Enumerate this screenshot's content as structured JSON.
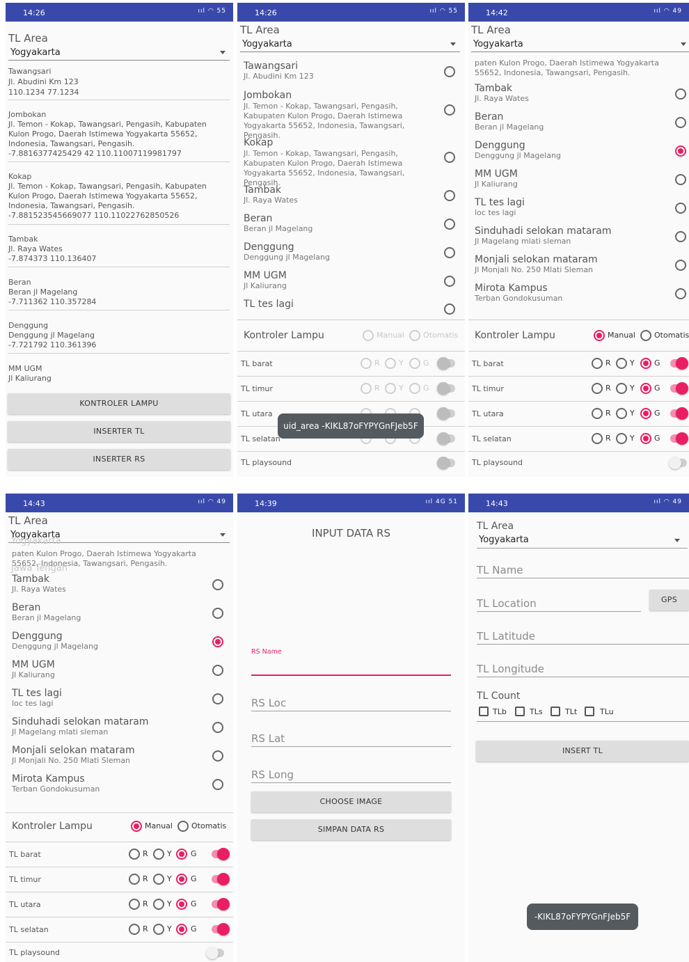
{
  "s1": {
    "time": "14:26",
    "status_icons": "ııl ◠ 55",
    "tl_area_label": "TL Area",
    "area_value": "Yogyakarta",
    "items": [
      {
        "name": "Tawangsari",
        "address": "Jl. Abudini Km 123",
        "coords": "110.1234   77.1234"
      },
      {
        "name": "Jombokan",
        "address": "Jl. Temon - Kokap, Tawangsari, Pengasih, Kabupaten Kulon Progo, Daerah Istimewa Yogyakarta 55652, Indonesia, Tawangsari, Pengasih.",
        "coords": "-7.8816377425429 42   110.11007119981797"
      },
      {
        "name": "Kokap",
        "address": "Jl. Temon - Kokap, Tawangsari, Pengasih, Kabupaten Kulon Progo, Daerah Istimewa Yogyakarta 55652, Indonesia, Tawangsari, Pengasih.",
        "coords": "-7.881523545669077   110.11022762850526"
      },
      {
        "name": "Tambak",
        "address": "Jl. Raya Wates",
        "coords": "-7.874373   110.136407"
      },
      {
        "name": "Beran",
        "address": "Beran jl Magelang",
        "coords": "-7.711362   110.357284"
      },
      {
        "name": "Denggung",
        "address": "Denggung  jl Magelang",
        "coords": "-7.721792   110.361396"
      },
      {
        "name": "MM UGM",
        "address": "Jl Kaliurang",
        "coords": ""
      }
    ],
    "buttons": [
      "KONTROLER LAMPU",
      "INSERTER TL",
      "INSERTER RS"
    ]
  },
  "s2": {
    "time": "14:26",
    "status_icons": "ııl ◠ 55",
    "tl_area_label": "TL Area",
    "area_value": "Yogyakarta",
    "items": [
      {
        "name": "Tawangsari",
        "address": "Jl. Abudini Km 123"
      },
      {
        "name": "Jombokan",
        "address": "Jl. Temon - Kokap, Tawangsari, Pengasih, Kabupaten Kulon Progo, Daerah Istimewa Yogyakarta 55652, Indonesia, Tawangsari, Pengasih."
      },
      {
        "name": "Kokap",
        "address": "Jl. Temon - Kokap, Tawangsari, Pengasih, Kabupaten Kulon Progo, Daerah Istimewa Yogyakarta 55652, Indonesia, Tawangsari, Pengasih."
      },
      {
        "name": "Tambak",
        "address": "Jl. Raya Wates"
      },
      {
        "name": "Beran",
        "address": "Beran jl Magelang"
      },
      {
        "name": "Denggung",
        "address": "Denggung  jl Magelang"
      },
      {
        "name": "MM UGM",
        "address": "Jl Kaliurang"
      },
      {
        "name": "TL tes lagi",
        "address": ""
      }
    ],
    "kontroler_label": "Kontroler Lampu",
    "manual": "Manual",
    "otomatis": "Otomatis",
    "lights": [
      "TL barat",
      "TL timur",
      "TL utara",
      "TL selatan",
      "TL playsound"
    ],
    "r": "R",
    "y": "Y",
    "g": "G",
    "toast": "uid_area -KIKL87oFYPYGnFJeb5F"
  },
  "s3": {
    "time": "14:42",
    "status_icons": "ııl ◠ 49",
    "tl_area_label": "TL Area",
    "area_value": "Yogyakarta",
    "partial_text": "paten Kulon Progo, Daerah Istimewa Yogyakarta 55652, Indonesia, Tawangsari, Pengasih.",
    "items": [
      {
        "name": "Tambak",
        "address": "Jl. Raya Wates",
        "selected": false
      },
      {
        "name": "Beran",
        "address": "Beran jl Magelang",
        "selected": false
      },
      {
        "name": "Denggung",
        "address": "Denggung  jl Magelang",
        "selected": true
      },
      {
        "name": "MM UGM",
        "address": "Jl Kaliurang",
        "selected": false
      },
      {
        "name": "TL tes lagi",
        "address": "loc tes lagi",
        "selected": false
      },
      {
        "name": "Sinduhadi selokan mataram",
        "address": "Jl Magelang mlati sleman",
        "selected": false
      },
      {
        "name": "Monjali selokan mataram",
        "address": "Jl Monjali No. 250 Mlati Sleman",
        "selected": false
      },
      {
        "name": "Mirota Kampus",
        "address": "Terban Gondokusuman",
        "selected": false
      }
    ],
    "kontroler_label": "Kontroler Lampu",
    "manual": "Manual",
    "otomatis": "Otomatis",
    "lights": [
      "TL barat",
      "TL timur",
      "TL utara",
      "TL selatan",
      "TL playsound"
    ],
    "r": "R",
    "y": "Y",
    "g": "G"
  },
  "s4": {
    "time": "14:43",
    "status_icons": "ııl ◠ 49",
    "tl_area_label": "TL Area",
    "area_value": "Yogyakarta",
    "ghost_1": "Yogyakarta",
    "ghost_2": "Jawa Tengah",
    "partial_text": "paten Kulon Progo, Daerah Istimewa Yogyakarta 55652, Indonesia, Tawangsari, Pengasih.",
    "items": [
      {
        "name": "Tambak",
        "address": "Jl. Raya Wates",
        "selected": false
      },
      {
        "name": "Beran",
        "address": "Beran jl Magelang",
        "selected": false
      },
      {
        "name": "Denggung",
        "address": "Denggung  jl Magelang",
        "selected": true
      },
      {
        "name": "MM UGM",
        "address": "Jl Kaliurang",
        "selected": false
      },
      {
        "name": "TL tes lagi",
        "address": "loc tes lagi",
        "selected": false
      },
      {
        "name": "Sinduhadi selokan mataram",
        "address": "Jl Magelang mlati sleman",
        "selected": false
      },
      {
        "name": "Monjali selokan mataram",
        "address": "Jl Monjali No. 250 Mlati Sleman",
        "selected": false
      },
      {
        "name": "Mirota Kampus",
        "address": "Terban Gondokusuman",
        "selected": false
      }
    ],
    "kontroler_label": "Kontroler Lampu",
    "manual": "Manual",
    "otomatis": "Otomatis",
    "lights": [
      "TL barat",
      "TL timur",
      "TL utara",
      "TL selatan",
      "TL playsound"
    ],
    "r": "R",
    "y": "Y",
    "g": "G"
  },
  "s5": {
    "time": "14:39",
    "status_icons": "ııl 4G 51",
    "title": "INPUT DATA RS",
    "rs_name_label": "RS Name",
    "rs_loc": "RS Loc",
    "rs_lat": "RS Lat",
    "rs_long": "RS Long",
    "choose_image": "CHOOSE IMAGE",
    "simpan": "SIMPAN DATA RS"
  },
  "s6": {
    "time": "14:43",
    "status_icons": "ııl ◠ 49",
    "tl_area_label": "TL Area",
    "area_value": "Yogyakarta",
    "tl_name": "TL Name",
    "tl_location": "TL Location",
    "gps": "GPS",
    "tl_latitude": "TL Latitude",
    "tl_longitude": "TL Longitude",
    "tl_count": "TL Count",
    "checkboxes": [
      "TLb",
      "TLs",
      "TLt",
      "TLu"
    ],
    "insert_tl": "INSERT TL",
    "toast": "-KIKL87oFYPYGnFJeb5F"
  },
  "colors": {
    "status_bar": "#3949ab",
    "accent": "#e91e63",
    "button": "#dedede"
  }
}
